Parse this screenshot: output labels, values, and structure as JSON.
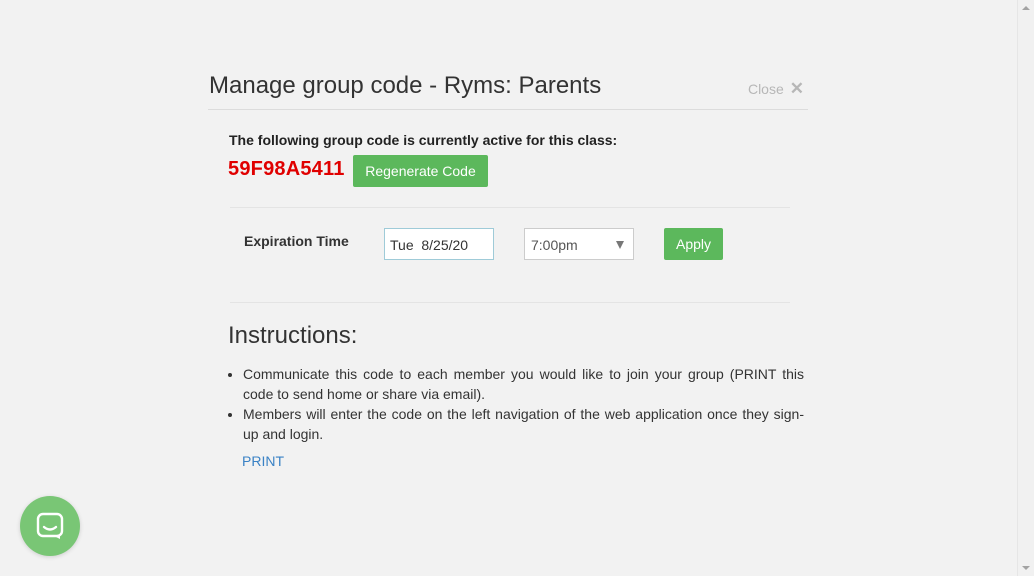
{
  "modal": {
    "title": "Manage group code - Ryms: Parents",
    "close_label": "Close",
    "close_icon": "close-icon"
  },
  "group_code": {
    "active_text": "The following group code is currently active for this class:",
    "code": "59F98A5411",
    "regenerate_label": "Regenerate Code"
  },
  "expiration": {
    "label": "Expiration Time",
    "date_value": "Tue  8/25/20",
    "time_value": "7:00pm",
    "apply_label": "Apply"
  },
  "instructions": {
    "title": "Instructions:",
    "items": [
      "Communicate this code to each member you would like to join your group (PRINT this code to send home or share via email).",
      "Members will enter the code on the left navigation of the web application once they sign-up and login."
    ],
    "print_label": "PRINT"
  },
  "chat": {
    "icon": "chat-icon"
  },
  "colors": {
    "code_red": "#e00000",
    "button_green": "#5cb85c",
    "link_blue": "#3a82c5",
    "chat_green": "#79c675"
  }
}
